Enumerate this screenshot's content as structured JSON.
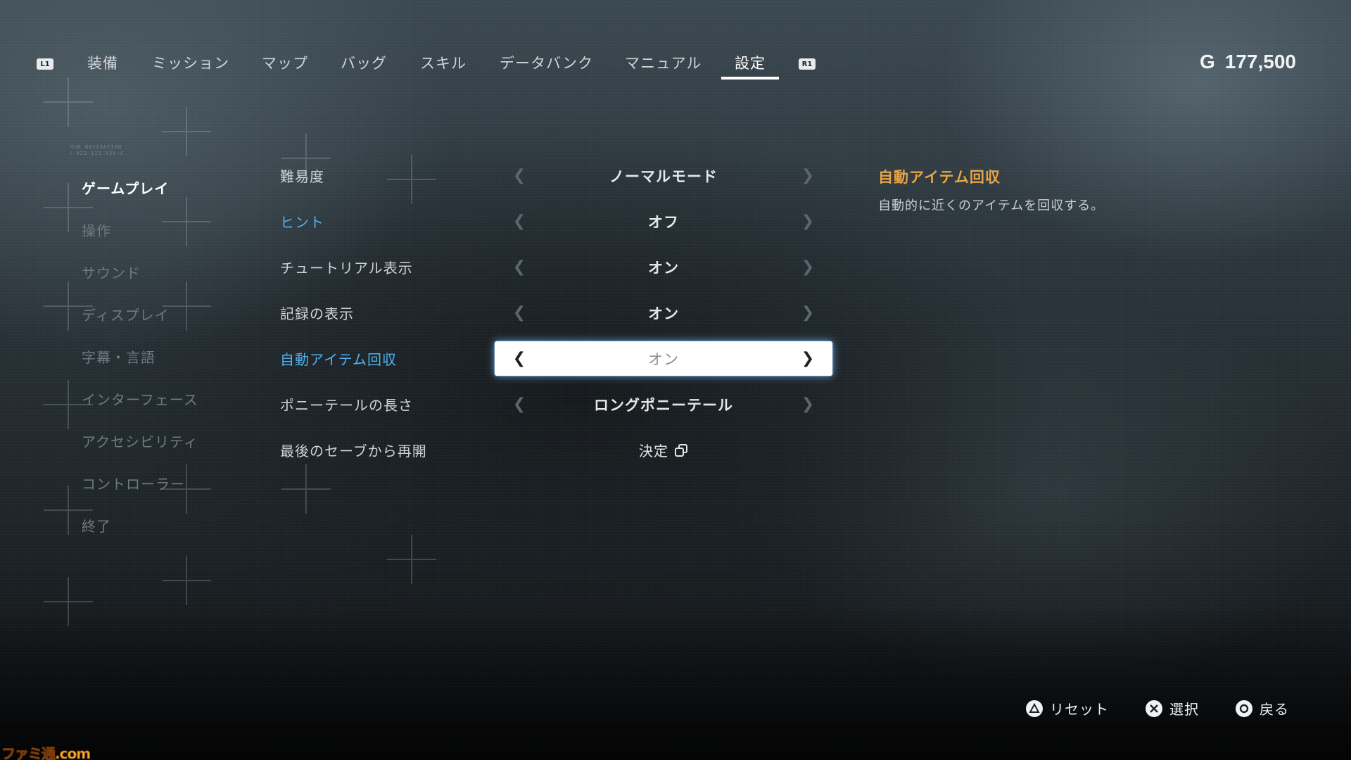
{
  "nav": {
    "left_shoulder": "L1",
    "right_shoulder": "R1",
    "tabs": [
      {
        "label": "装備"
      },
      {
        "label": "ミッション"
      },
      {
        "label": "マップ"
      },
      {
        "label": "バッグ"
      },
      {
        "label": "スキル"
      },
      {
        "label": "データバンク"
      },
      {
        "label": "マニュアル"
      },
      {
        "label": "設定"
      }
    ],
    "active_tab": "設定"
  },
  "currency": {
    "symbol": "G",
    "amount": "177,500"
  },
  "hud_caption": [
    "HUD NAVIGATION",
    "Ⅰ-023-115 XXX-A"
  ],
  "sidebar": {
    "items": [
      {
        "label": "ゲームプレイ"
      },
      {
        "label": "操作"
      },
      {
        "label": "サウンド"
      },
      {
        "label": "ディスプレイ"
      },
      {
        "label": "字幕・言語"
      },
      {
        "label": "インターフェース"
      },
      {
        "label": "アクセシビリティ"
      },
      {
        "label": "コントローラー"
      },
      {
        "label": "終了"
      }
    ],
    "active": "ゲームプレイ"
  },
  "settings": [
    {
      "label": "難易度",
      "value": "ノーマルモード"
    },
    {
      "label": "ヒント",
      "value": "オフ"
    },
    {
      "label": "チュートリアル表示",
      "value": "オン"
    },
    {
      "label": "記録の表示",
      "value": "オン"
    },
    {
      "label": "自動アイテム回収",
      "value": "オン"
    },
    {
      "label": "ポニーテールの長さ",
      "value": "ロングポニーテール"
    },
    {
      "label": "最後のセーブから再開",
      "value": "決定"
    }
  ],
  "description": {
    "title": "自動アイテム回収",
    "body": "自動的に近くのアイテムを回収する。"
  },
  "prompts": [
    {
      "icon": "triangle-button-icon",
      "label": "リセット"
    },
    {
      "icon": "cross-button-icon",
      "label": "選択"
    },
    {
      "icon": "circle-button-icon",
      "label": "戻る"
    }
  ],
  "watermark": "ファミ通.com",
  "colors": {
    "highlight_blue": "#4fb3f2",
    "description_orange": "#e8a447"
  }
}
